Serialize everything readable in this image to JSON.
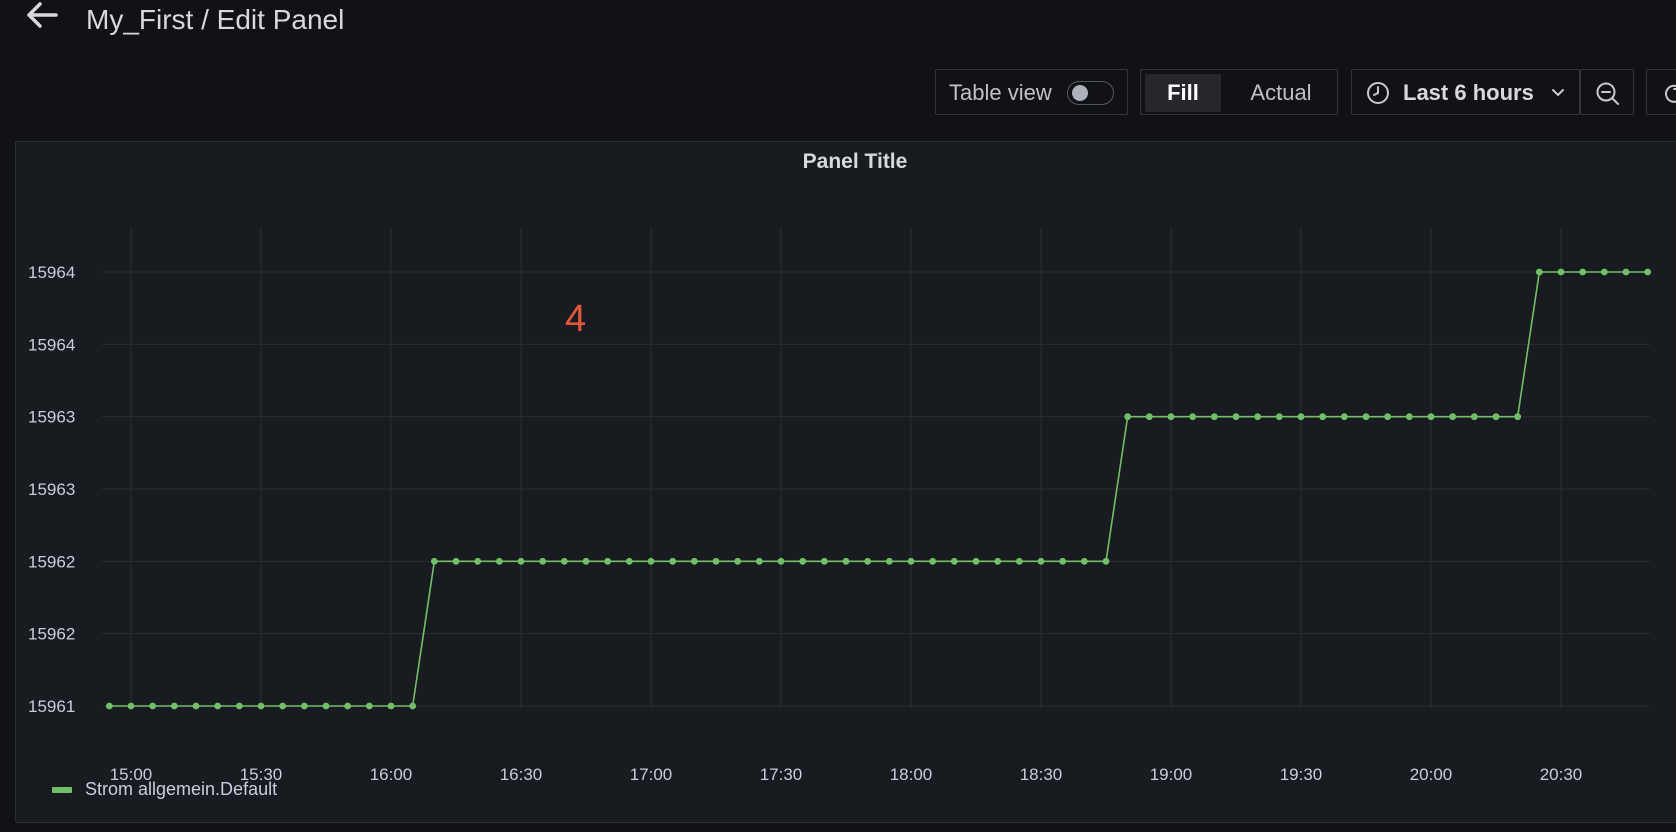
{
  "header": {
    "title": "My_First / Edit Panel",
    "back_icon": "arrow-left-icon"
  },
  "toolbar": {
    "table_view_label": "Table view",
    "table_view_on": false,
    "fill_label": "Fill",
    "actual_label": "Actual",
    "selected_mode": "Fill",
    "time_range_label": "Last 6 hours",
    "icons": [
      "clock-icon",
      "chevron-down-icon",
      "zoom-out-icon",
      "refresh-icon"
    ]
  },
  "panel": {
    "title": "Panel Title",
    "annotation": "4",
    "legend_label": "Strom allgemein.Default"
  },
  "chart_data": {
    "type": "line",
    "title": "Panel Title",
    "xlabel": "",
    "ylabel": "",
    "x_ticks": [
      "15:00",
      "15:30",
      "16:00",
      "16:30",
      "17:00",
      "17:30",
      "18:00",
      "18:30",
      "19:00",
      "19:30",
      "20:00",
      "20:30"
    ],
    "y_ticks": [
      "15964",
      "15964",
      "15963",
      "15963",
      "15962",
      "15962",
      "15961"
    ],
    "ylim": [
      15961,
      15964
    ],
    "grid": true,
    "legend": "bottom-left",
    "colors": {
      "series": "#73bf69"
    },
    "series": [
      {
        "name": "Strom allgemein.Default",
        "segments": [
          {
            "from": "14:55",
            "to": "16:05",
            "interval_min": 5,
            "y": 15961
          },
          {
            "from": "16:10",
            "to": "18:45",
            "interval_min": 5,
            "y": 15962
          },
          {
            "from": "18:50",
            "to": "20:20",
            "interval_min": 5,
            "y": 15963
          },
          {
            "from": "20:25",
            "to": "20:50",
            "interval_min": 5,
            "y": 15964
          }
        ]
      }
    ]
  }
}
